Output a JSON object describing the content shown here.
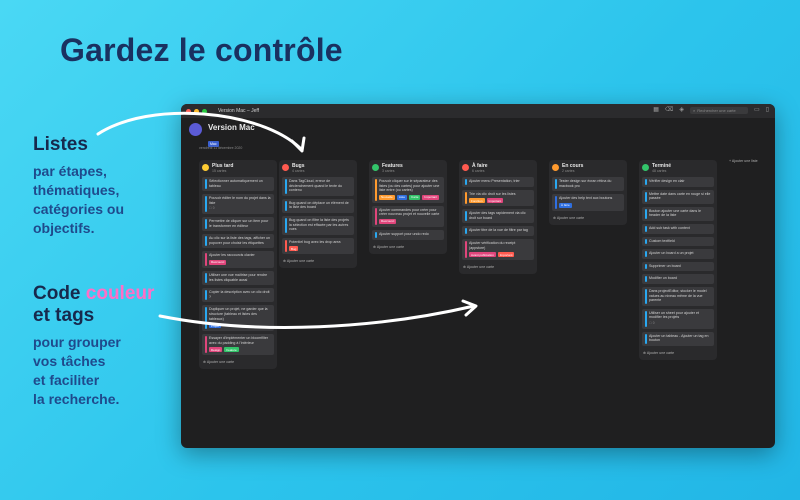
{
  "headline": "Gardez le contrôle",
  "lists_block": {
    "title": "Listes",
    "sub": [
      "par étapes,",
      "thématiques,",
      "catégories ou",
      "objectifs."
    ]
  },
  "tags_block": {
    "title_prefix": "Code ",
    "title_accent": "couleur",
    "title_suffix": "et tags",
    "sub": [
      "pour grouper",
      "vos tâches",
      "et faciliter",
      "la recherche."
    ]
  },
  "window": {
    "title": "Version Mac – Jeff",
    "search_placeholder": "Rechercher une carte",
    "board_name": "Version Mac",
    "board_tag": "Mac",
    "board_date": "vendredi 11 décembre 2020",
    "add_list": "+ Ajouter une liste",
    "add_card": "Ajouter une carte"
  },
  "colors": {
    "red": "#ff5a4f",
    "green": "#33c46a",
    "yellow": "#ffcc33",
    "orange": "#ff9a2e",
    "blue": "#2aa8f0",
    "purple": "#5b5bd6",
    "pink": "#e0457b",
    "tagblue": "#2f6fe0"
  },
  "columns": [
    {
      "title": "Plus tard",
      "count": "15 cartes",
      "icon": "clock-icon",
      "color": "#ffcc33",
      "cards": [
        {
          "text": "Sélectionner automatiquement un tableau",
          "bar": "#2aa8f0"
        },
        {
          "text": "Pouvoir éditer le nom du projet dans la liste",
          "bar": "#2aa8f0",
          "meta": "☐ 0"
        },
        {
          "text": "Permettre de cliquer sur un item pour le transformer en éditeur",
          "bar": "#2aa8f0"
        },
        {
          "text": "Au clic sur la liste des tags, afficher un popover pour choisir les étiquettes",
          "bar": "#2aa8f0"
        },
        {
          "text": "Ajouter les raccourcis clavier",
          "bar": "#e0457b",
          "tags": [
            {
              "label": "Raccourci",
              "color": "#e0457b"
            }
          ]
        },
        {
          "text": "Utiliser une vue maîtrise pour rendre les listes cliquable aussi",
          "bar": "#2aa8f0"
        },
        {
          "text": "Copier la description avec un clic droit ?",
          "bar": "#2aa8f0"
        },
        {
          "text": "Dupliquer un projet, ne garder que la structure (tableau et listes des tableaux)",
          "bar": "#2aa8f0",
          "tags": [
            {
              "label": "Projet",
              "color": "#2f6fe0"
            }
          ]
        },
        {
          "text": "Essayer d'implémenter un bloomfilter avec du padding à l'intérieur",
          "bar": "#e0457b",
          "tags": [
            {
              "label": "Design",
              "color": "#e0457b"
            },
            {
              "label": "Feature",
              "color": "#33c46a"
            }
          ]
        }
      ]
    },
    {
      "title": "Bugs",
      "count": "4 cartes",
      "icon": "bug-icon",
      "color": "#ff5a4f",
      "cards": [
        {
          "text": "Dans TagCloud, erreur de déclenchement quand le texte du contenu",
          "bar": "#2aa8f0"
        },
        {
          "text": "Bug quand on déplace un élément de la liste des board",
          "bar": "#2aa8f0"
        },
        {
          "text": "Bug quand on filtre la liste des projets la sélection est effacée par les autres vues",
          "bar": "#2aa8f0"
        },
        {
          "text": "Potentiel bug avec les drop area",
          "bar": "#ff5a4f",
          "tags": [
            {
              "label": "Bug",
              "color": "#ff5a4f"
            }
          ]
        }
      ]
    },
    {
      "title": "Features",
      "count": "3 cartes",
      "icon": "plus-circle-icon",
      "color": "#33c46a",
      "cards": [
        {
          "text": "Pouvoir cliquer sur le séparateur des listes (ou des cartes) pour ajouter une liste entre (ou cartes)",
          "bar": "#ff9a2e",
          "tags": [
            {
              "label": "Nouvelle",
              "color": "#ff9a2e"
            },
            {
              "label": "Liste",
              "color": "#2f6fe0"
            },
            {
              "label": "Carte",
              "color": "#33c46a"
            },
            {
              "label": "Important",
              "color": "#e0457b"
            }
          ]
        },
        {
          "text": "Ajouter commandes pour créer pour créer nouveau projet et nouvelle carte",
          "bar": "#e0457b",
          "tags": [
            {
              "label": "Raccourci",
              "color": "#e0457b"
            }
          ]
        },
        {
          "text": "Ajouter support pour undo redo",
          "bar": "#2aa8f0"
        }
      ]
    },
    {
      "title": "À faire",
      "count": "6 cartes",
      "icon": "list-icon",
      "color": "#ff5a4f",
      "cards": [
        {
          "text": "Ajouter menu Presentation, trier",
          "bar": "#2aa8f0"
        },
        {
          "text": "Trie via clic droit sur les listes",
          "bar": "#ff9a2e",
          "tags": [
            {
              "label": "Fonction",
              "color": "#ff9a2e"
            },
            {
              "label": "Important",
              "color": "#e0457b"
            }
          ]
        },
        {
          "text": "Ajouter des tags rapidement via clic droit sur board",
          "bar": "#2aa8f0"
        },
        {
          "text": "Ajouter titre de la vue de filtre par tag",
          "bar": "#2aa8f0"
        },
        {
          "text": "Ajouter vérification du receipt (appstore)",
          "bar": "#e0457b",
          "tags": [
            {
              "label": "Avant publication",
              "color": "#e0457b"
            },
            {
              "label": "Important",
              "color": "#ff5a4f"
            }
          ]
        }
      ]
    },
    {
      "title": "En cours",
      "count": "2 cartes",
      "icon": "progress-icon",
      "color": "#ff9a2e",
      "cards": [
        {
          "text": "Tester design sur écran rétina du macbook pro",
          "bar": "#2aa8f0"
        },
        {
          "text": "Ajouter des help text aux boutons",
          "bar": "#2f6fe0",
          "tags": [
            {
              "label": "À faire",
              "color": "#2f6fe0"
            }
          ]
        }
      ]
    },
    {
      "title": "Terminé",
      "count": "48 cartes",
      "icon": "check-icon",
      "color": "#33c46a",
      "cards": [
        {
          "text": "Vérifier design en clair",
          "bar": "#2aa8f0"
        },
        {
          "text": "Mettre date dans carte en rouge si elle passée",
          "bar": "#2aa8f0"
        },
        {
          "text": "Bouton ajouter une carte dans le header de la liste",
          "bar": "#2aa8f0"
        },
        {
          "text": "Add sub task with context",
          "bar": "#2aa8f0"
        },
        {
          "text": "Custom textfield",
          "bar": "#2aa8f0"
        },
        {
          "text": "Ajouter un board a un projet",
          "bar": "#2aa8f0"
        },
        {
          "text": "Supprimer un board",
          "bar": "#2aa8f0"
        },
        {
          "text": "Modifier un board",
          "bar": "#2aa8f0"
        },
        {
          "text": "Dans projectEditor, stocker le model values au niveau même de la vue parente",
          "bar": "#2aa8f0"
        },
        {
          "text": "Utiliser un sheet pour ajouter et modifier les projets",
          "bar": "#2aa8f0",
          "meta": "☐ 0"
        },
        {
          "text": "Ajouter un tableau - Ajouter un tag en bouton",
          "bar": "#2aa8f0"
        }
      ]
    }
  ]
}
